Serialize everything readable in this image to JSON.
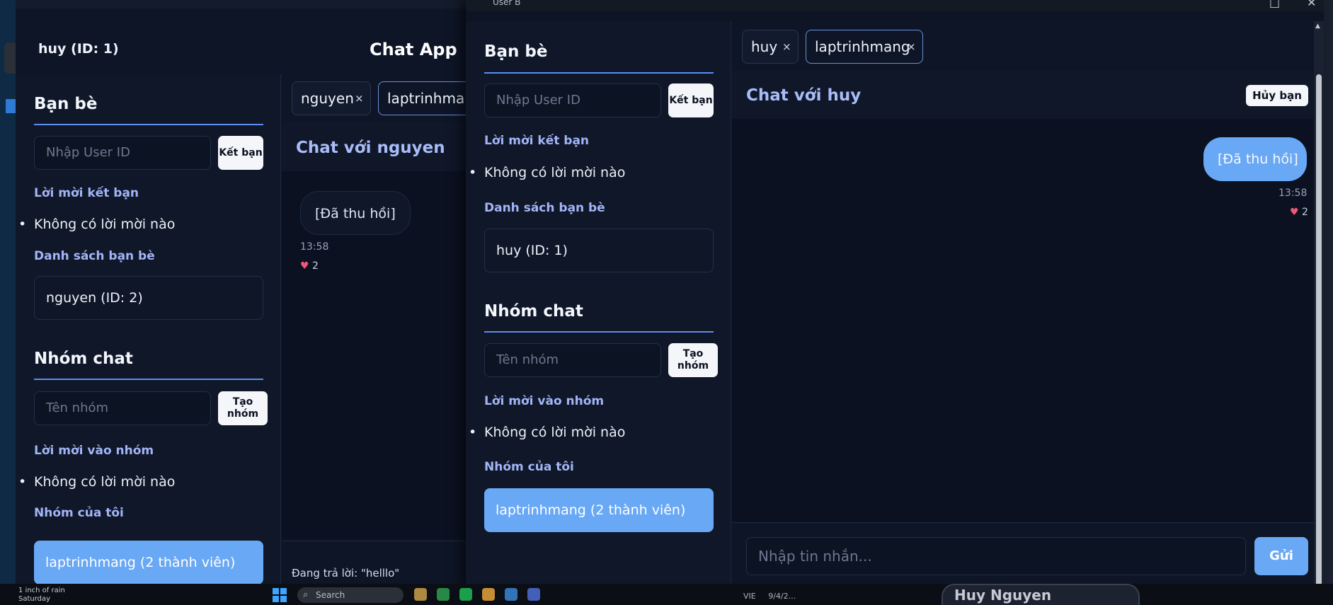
{
  "taskbar": {
    "weather_line1": "1 inch of rain",
    "weather_line2": "Saturday",
    "search_label": "Search",
    "user_name": "Huy Nguyen",
    "lang": "VIE",
    "date": "9/4/2..."
  },
  "window_back": {
    "current_user": "huy (ID: 1)",
    "app_title": "Chat App",
    "sidebar": {
      "friends_heading": "Bạn bè",
      "user_id_placeholder": "Nhập User ID",
      "add_friend_button": "Kết bạn",
      "friend_requests_heading": "Lời mời kết bạn",
      "friend_requests_empty": "Không có lời mời nào",
      "friend_list_heading": "Danh sách bạn bè",
      "friends": [
        "nguyen (ID: 2)"
      ],
      "groups_heading": "Nhóm chat",
      "group_name_placeholder": "Tên nhóm",
      "create_group_button": "Tạo nhóm",
      "group_invites_heading": "Lời mời vào nhóm",
      "group_invites_empty": "Không có lời mời nào",
      "my_groups_heading": "Nhóm của tôi",
      "groups": [
        "laptrinhmang (2 thành viên)"
      ]
    },
    "tabs": [
      {
        "label": "nguyen",
        "close": "×"
      },
      {
        "label": "laptrinhmang",
        "close": "×"
      }
    ],
    "chat_title": "Chat với nguyen",
    "messages": [
      {
        "text": "[Đã thu hồi]",
        "time": "13:58",
        "reaction": "2"
      }
    ],
    "reply_text": "Đang trả lời: \"helllo\""
  },
  "window_front": {
    "title": "User B",
    "sidebar": {
      "friends_heading": "Bạn bè",
      "user_id_placeholder": "Nhập User ID",
      "add_friend_button": "Kết bạn",
      "friend_requests_heading": "Lời mời kết bạn",
      "friend_requests_empty": "Không có lời mời nào",
      "friend_list_heading": "Danh sách bạn bè",
      "friends": [
        "huy (ID: 1)"
      ],
      "groups_heading": "Nhóm chat",
      "group_name_placeholder": "Tên nhóm",
      "create_group_button": "Tạo nhóm",
      "group_invites_heading": "Lời mời vào nhóm",
      "group_invites_empty": "Không có lời mời nào",
      "my_groups_heading": "Nhóm của tôi",
      "groups": [
        "laptrinhmang (2 thành viên)"
      ]
    },
    "tabs": [
      {
        "label": "huy",
        "close": "×"
      },
      {
        "label": "laptrinhmang",
        "close": "×"
      }
    ],
    "chat_title": "Chat với huy",
    "unfriend_button": "Hủy bạn",
    "messages": [
      {
        "text": "[Đã thu hồi]",
        "time": "13:58",
        "reaction": "2"
      }
    ],
    "message_placeholder": "Nhập tin nhắn...",
    "send_button": "Gửi"
  },
  "colors": {
    "accent": "#69a8f5",
    "heading_accent": "#a3b5f7",
    "background": "#0d1424"
  }
}
